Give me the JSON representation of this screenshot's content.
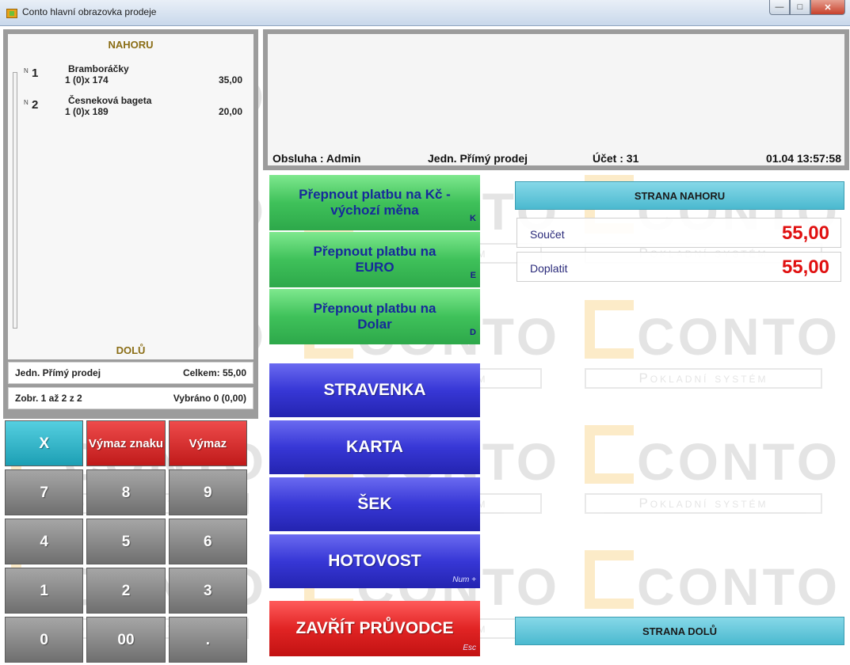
{
  "window": {
    "title": "Conto hlavní obrazovka prodeje"
  },
  "watermark": {
    "logo": "CONTO",
    "subtitle": "Pokladní systém"
  },
  "receipt": {
    "nav_up": "NAHORU",
    "nav_down": "DOLŮ",
    "items": [
      {
        "marker": "N",
        "index": "1",
        "name": "Bramboráčky",
        "qty": "1 (0)x 174",
        "price": "35,00"
      },
      {
        "marker": "N",
        "index": "2",
        "name": "Česneková bageta",
        "qty": "1 (0)x 189",
        "price": "20,00"
      }
    ],
    "mode": "Jedn. Přímý prodej",
    "total": "Celkem: 55,00",
    "paging": "Zobr. 1 až 2 z 2",
    "selected": "Vybráno 0 (0,00)"
  },
  "display": {
    "operator": "Obsluha : Admin",
    "mode": "Jedn. Přímý prodej",
    "account": "Účet : 31",
    "datetime": "01.04 13:57:58"
  },
  "keypad": {
    "clear": "X",
    "backspace": "Výmaz znaku",
    "delete": "Výmaz",
    "keys": [
      "7",
      "8",
      "9",
      "4",
      "5",
      "6",
      "1",
      "2",
      "3",
      "0",
      "00",
      "."
    ]
  },
  "payment": {
    "czk": {
      "label": "Přepnout platbu na Kč - výchozí měna",
      "hotkey": "K"
    },
    "eur": {
      "label": "Přepnout platbu na EURO",
      "hotkey": "E"
    },
    "usd": {
      "label": "Přepnout platbu na Dolar",
      "hotkey": "D"
    },
    "voucher": {
      "label": "STRAVENKA"
    },
    "card": {
      "label": "KARTA"
    },
    "cheque": {
      "label": "ŠEK"
    },
    "cash": {
      "label": "HOTOVOST",
      "hotkey": "Num +"
    },
    "close": {
      "label": "ZAVŘÍT PRŮVODCE",
      "hotkey": "Esc"
    }
  },
  "summary": {
    "page_up": "STRANA NAHORU",
    "page_down": "STRANA DOLŮ",
    "sum_label": "Součet",
    "sum_value": "55,00",
    "due_label": "Doplatit",
    "due_value": "55,00"
  },
  "colors": {
    "accent_green": "#3fc15a",
    "accent_blue": "#3737d6",
    "accent_red": "#e12424",
    "accent_teal": "#4bb9cf",
    "amount_red": "#e01010"
  }
}
